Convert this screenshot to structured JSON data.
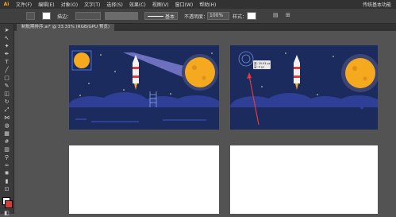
{
  "menu": {
    "logo": "Ai",
    "items": [
      "文件(F)",
      "编辑(E)",
      "对象(O)",
      "文字(T)",
      "选择(S)",
      "效果(C)",
      "视图(V)",
      "窗口(W)",
      "帮助(H)"
    ],
    "workspace": "传统基本功能"
  },
  "control_bar": {
    "stroke_label": "描边：",
    "stroke_style": "基本",
    "opacity_label": "不透明度：",
    "opacity_value": "100%",
    "style_label": "样式："
  },
  "document": {
    "tab_title": "制航期排序.ai* @ 33.33% (RGB/GPU 预览)"
  },
  "tooltip": {
    "line1": "宽: 29.93 px",
    "line2": "高: 4 px"
  },
  "colors": {
    "sky": "#1b2b5e",
    "moon": "#f5a91e",
    "hills": "#2f3f95",
    "rocket": "#f2f2f2",
    "beam": "#7a7ccf",
    "arrow": "#e33b3b"
  }
}
